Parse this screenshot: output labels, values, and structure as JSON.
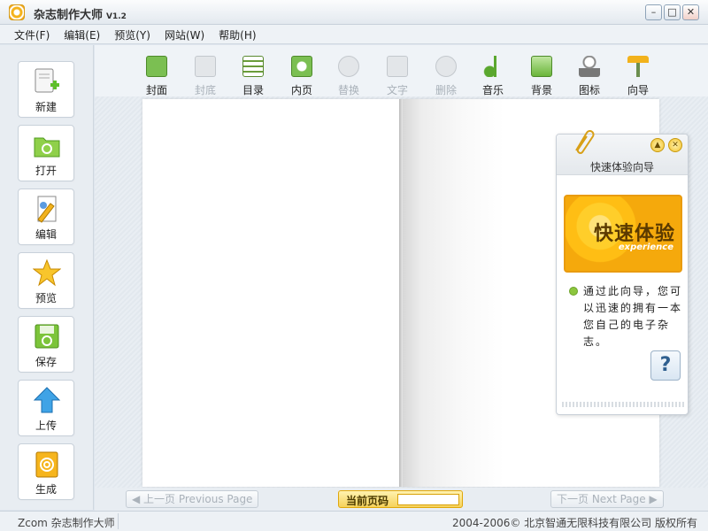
{
  "window": {
    "title": "杂志制作大师",
    "version": "V1.2",
    "min_icon": "minimize-icon",
    "max_icon": "maximize-icon",
    "close_icon": "close-icon"
  },
  "menu": [
    {
      "label": "文件(F)"
    },
    {
      "label": "编辑(E)"
    },
    {
      "label": "预览(Y)"
    },
    {
      "label": "网站(W)"
    },
    {
      "label": "帮助(H)"
    }
  ],
  "sidebar": [
    {
      "label": "新建",
      "icon": "new-doc-icon"
    },
    {
      "label": "打开",
      "icon": "folder-open-icon"
    },
    {
      "label": "编辑",
      "icon": "edit-icon"
    },
    {
      "label": "预览",
      "icon": "star-icon"
    },
    {
      "label": "保存",
      "icon": "save-icon"
    },
    {
      "label": "上传",
      "icon": "upload-arrow-icon"
    },
    {
      "label": "生成",
      "icon": "build-book-icon"
    }
  ],
  "toolbar": [
    {
      "label": "封面",
      "icon": "cover-icon",
      "enabled": true
    },
    {
      "label": "封底",
      "icon": "back-cover-icon",
      "enabled": false
    },
    {
      "label": "目录",
      "icon": "contents-icon",
      "enabled": true
    },
    {
      "label": "内页",
      "icon": "inner-page-icon",
      "enabled": true
    },
    {
      "label": "替换",
      "icon": "replace-icon",
      "enabled": false
    },
    {
      "label": "文字",
      "icon": "text-icon",
      "enabled": false
    },
    {
      "label": "删除",
      "icon": "delete-icon",
      "enabled": false
    },
    {
      "label": "音乐",
      "icon": "music-icon",
      "enabled": true
    },
    {
      "label": "背景",
      "icon": "background-icon",
      "enabled": true
    },
    {
      "label": "图标",
      "icon": "chess-icon",
      "enabled": true
    },
    {
      "label": "向导",
      "icon": "signpost-icon",
      "enabled": true
    }
  ],
  "nav": {
    "prev_label": "上一页 Previous Page",
    "next_label": "下一页 Next Page",
    "current_label": "当前页码",
    "current_value": ""
  },
  "wizard": {
    "title": "快速体验向导",
    "banner_cn": "快速体验",
    "banner_en": "experience",
    "text": "通过此向导，您可以迅速的拥有一本您自己的电子杂志。",
    "help": "?"
  },
  "status": {
    "left": "Zcom 杂志制作大师",
    "right": "2004-2006© 北京智通无限科技有限公司 版权所有"
  },
  "colors": {
    "accent": "#f2b21c",
    "banner": "#ffbe14"
  }
}
